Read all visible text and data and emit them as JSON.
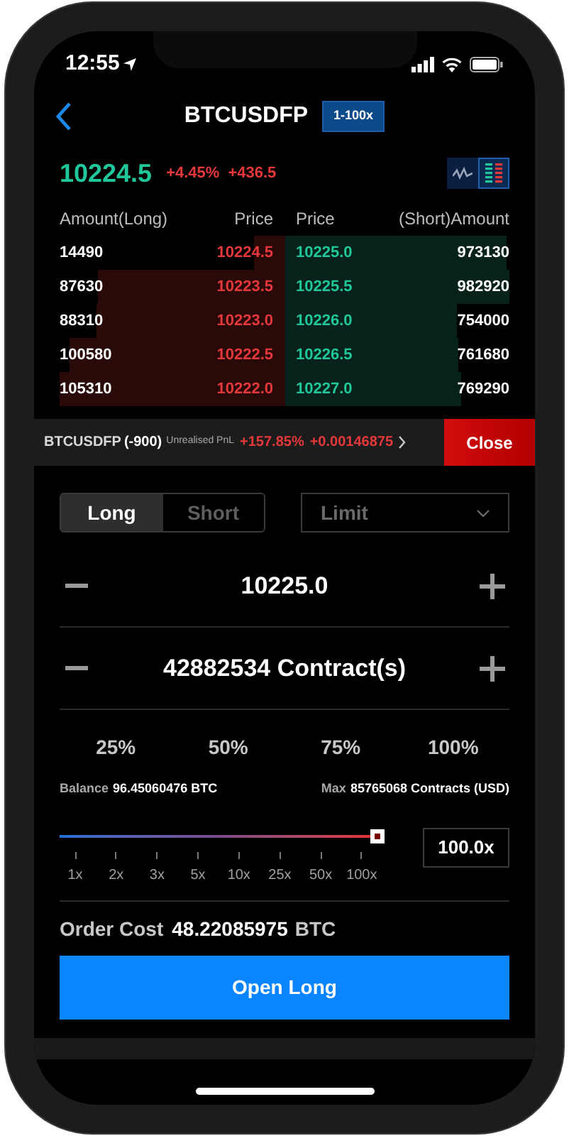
{
  "status_bar": {
    "time": "12:55"
  },
  "header": {
    "symbol": "BTCUSDFP",
    "leverage_badge": "1-100x"
  },
  "ticker": {
    "last_price": "10224.5",
    "change_percent": "+4.45%",
    "change": "+436.5",
    "views": [
      {
        "kind": "chart",
        "selected": false
      },
      {
        "kind": "orderbook",
        "selected": true
      }
    ]
  },
  "order_book": {
    "columns": [
      "Amount(Long)",
      "Price",
      "Price",
      "(Short)Amount"
    ],
    "rows": [
      {
        "bid": {
          "amount": "14490",
          "price": "10224.5"
        },
        "ask": {
          "price": "10225.0",
          "amount": "973130"
        }
      },
      {
        "bid": {
          "amount": "87630",
          "price": "10223.5"
        },
        "ask": {
          "price": "10225.5",
          "amount": "982920"
        }
      },
      {
        "bid": {
          "amount": "88310",
          "price": "10223.0"
        },
        "ask": {
          "price": "10226.0",
          "amount": "754000"
        }
      },
      {
        "bid": {
          "amount": "100580",
          "price": "10222.5"
        },
        "ask": {
          "price": "10226.5",
          "amount": "761680"
        }
      },
      {
        "bid": {
          "amount": "105310",
          "price": "10222.0"
        },
        "ask": {
          "price": "10227.0",
          "amount": "769290"
        }
      }
    ]
  },
  "position": {
    "symbol": "BTCUSDFP",
    "size": "(-900)",
    "pnl_label": "Unrealised PnL",
    "pnl_percent": "+157.85%",
    "pnl_value": "+0.00146875",
    "close_button": "Close"
  },
  "side_tabs": [
    {
      "label": "Long",
      "selected": true
    },
    {
      "label": "Short",
      "selected": false
    }
  ],
  "order_type": {
    "value": "Limit"
  },
  "price_input": {
    "value": "10225.0"
  },
  "quantity_input": {
    "value": "42882534 Contract(s)"
  },
  "percent_buttons": [
    "25%",
    "50%",
    "75%",
    "100%"
  ],
  "balance": {
    "label": "Balance",
    "value": "96.45060476 BTC"
  },
  "max": {
    "label": "Max",
    "value": "85765068 Contracts (USD)"
  },
  "leverage": {
    "level": 1,
    "ticks": [
      "1x",
      "2x",
      "3x",
      "5x",
      "10x",
      "25x",
      "50x",
      "100x"
    ],
    "value": "100.0x"
  },
  "order_cost": {
    "label": "Order Cost",
    "value": "48.22085975",
    "unit": "BTC"
  },
  "submit_button": "Open Long"
}
